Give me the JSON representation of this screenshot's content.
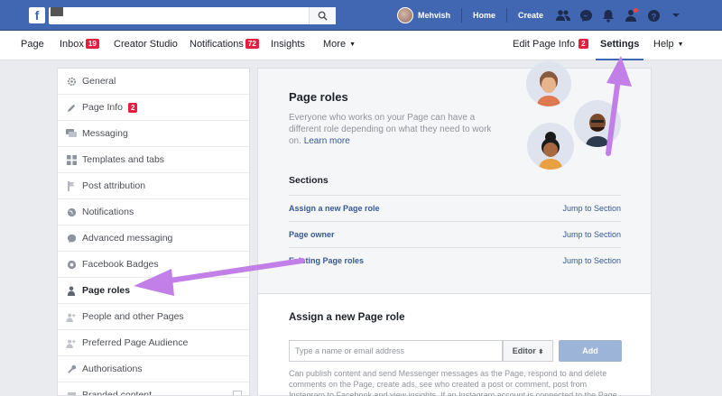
{
  "topbar": {
    "logo": "f",
    "user_name": "Mehvish",
    "home": "Home",
    "create": "Create"
  },
  "pagebar": {
    "page": "Page",
    "inbox": "Inbox",
    "inbox_count": "19",
    "creator_studio": "Creator Studio",
    "notifications": "Notifications",
    "notifications_count": "72",
    "insights": "Insights",
    "more": "More",
    "edit_page_info": "Edit Page Info",
    "edit_count": "2",
    "settings": "Settings",
    "help": "Help"
  },
  "sidebar": {
    "items": [
      {
        "label": "General",
        "icon": "gear-icon"
      },
      {
        "label": "Page Info",
        "icon": "pencil-icon",
        "badge": "2"
      },
      {
        "label": "Messaging",
        "icon": "chat-icon"
      },
      {
        "label": "Templates and tabs",
        "icon": "grid-icon"
      },
      {
        "label": "Post attribution",
        "icon": "flag-icon"
      },
      {
        "label": "Notifications",
        "icon": "globe-icon"
      },
      {
        "label": "Advanced messaging",
        "icon": "messenger-icon"
      },
      {
        "label": "Facebook Badges",
        "icon": "badge-icon"
      },
      {
        "label": "Page roles",
        "icon": "person-icon"
      },
      {
        "label": "People and other Pages",
        "icon": "people-icon"
      },
      {
        "label": "Preferred Page Audience",
        "icon": "audience-icon"
      },
      {
        "label": "Authorisations",
        "icon": "wrench-icon"
      },
      {
        "label": "Branded content",
        "icon": "branded-icon"
      }
    ],
    "active_index": 8
  },
  "main": {
    "title": "Page roles",
    "description": "Everyone who works on your Page can have a different role depending on what they need to work on.",
    "learn_more": "Learn more",
    "sections_heading": "Sections",
    "sections": [
      {
        "label": "Assign a new Page role",
        "jump": "Jump to Section"
      },
      {
        "label": "Page owner",
        "jump": "Jump to Section"
      },
      {
        "label": "Existing Page roles",
        "jump": "Jump to Section"
      }
    ]
  },
  "assign": {
    "title": "Assign a new Page role",
    "input_placeholder": "Type a name or email address",
    "role_value": "Editor",
    "add_label": "Add",
    "help_text": "Can publish content and send Messenger messages as the Page, respond to and delete comments on the Page, create ads, see who created a post or comment, post from Instagram to Facebook and view insights. If an Instagram account is connected to the Page, they can post to"
  },
  "colors": {
    "fb_blue": "#4267b2",
    "badge_red": "#e41e3f",
    "arrow_purple": "#c27fe8",
    "link_blue": "#365899"
  }
}
